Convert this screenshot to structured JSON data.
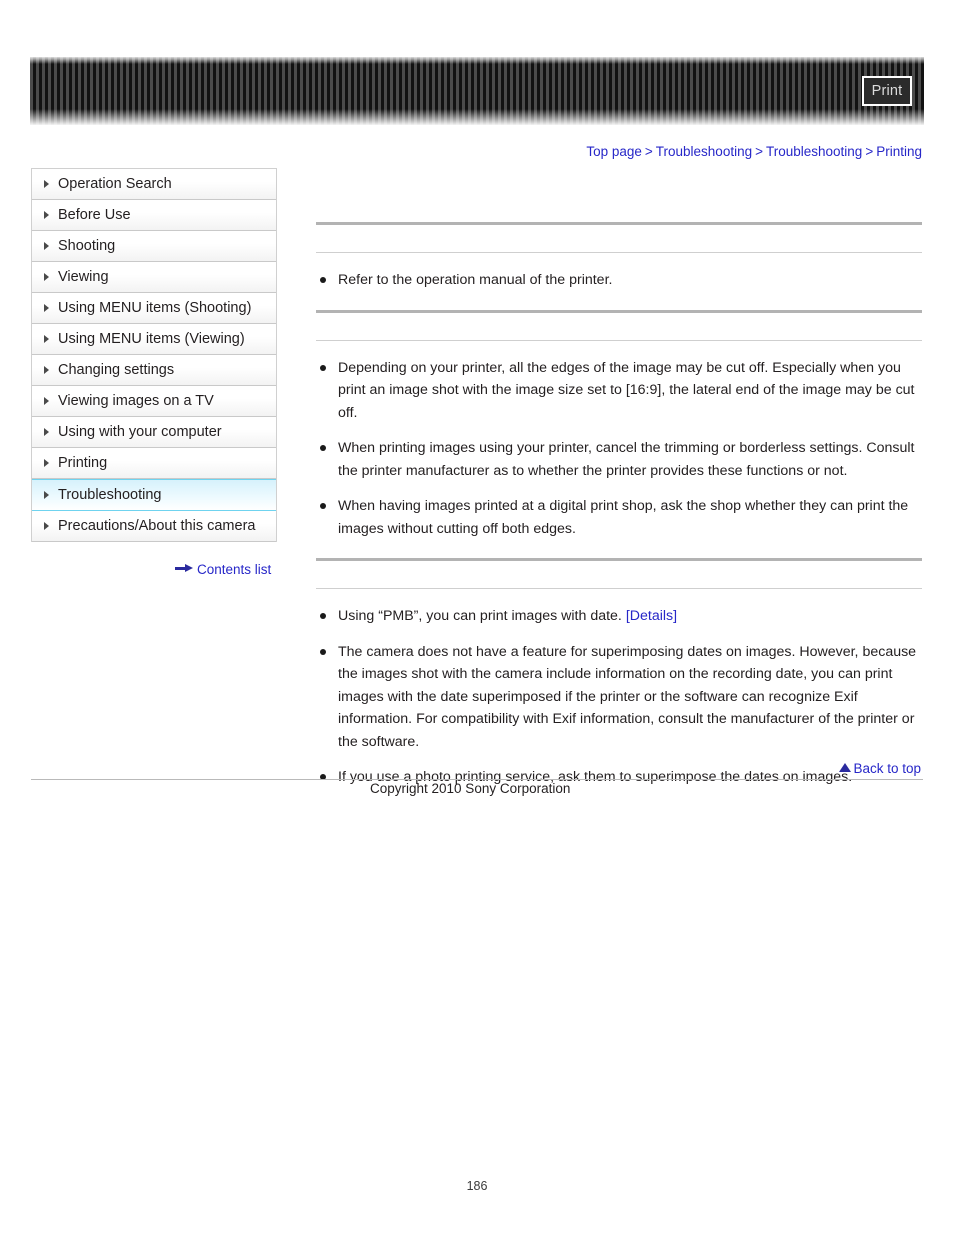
{
  "header": {
    "print_label": "Print"
  },
  "breadcrumb": {
    "items": [
      {
        "label": "Top page"
      },
      {
        "label": "Troubleshooting"
      },
      {
        "label": "Troubleshooting"
      },
      {
        "label": "Printing"
      }
    ],
    "separator": ">"
  },
  "sidebar": {
    "items": [
      {
        "label": "Operation Search",
        "active": false
      },
      {
        "label": "Before Use",
        "active": false
      },
      {
        "label": "Shooting",
        "active": false
      },
      {
        "label": "Viewing",
        "active": false
      },
      {
        "label": "Using MENU items (Shooting)",
        "active": false
      },
      {
        "label": "Using MENU items (Viewing)",
        "active": false
      },
      {
        "label": "Changing settings",
        "active": false
      },
      {
        "label": "Viewing images on a TV",
        "active": false
      },
      {
        "label": "Using with your computer",
        "active": false
      },
      {
        "label": "Printing",
        "active": false
      },
      {
        "label": "Troubleshooting",
        "active": true
      },
      {
        "label": "Precautions/About this camera",
        "active": false
      }
    ],
    "contents_list_label": "Contents list"
  },
  "main": {
    "sections": [
      {
        "title": "",
        "bullets": [
          {
            "text": "Refer to the operation manual of the printer."
          }
        ]
      },
      {
        "title": "",
        "bullets": [
          {
            "text": "Depending on your printer, all the edges of the image may be cut off. Especially when you print an image shot with the image size set to [16:9], the lateral end of the image may be cut off."
          },
          {
            "text": "When printing images using your printer, cancel the trimming or borderless settings. Consult the printer manufacturer as to whether the printer provides these functions or not."
          },
          {
            "text": "When having images printed at a digital print shop, ask the shop whether they can print the images without cutting off both edges."
          }
        ]
      },
      {
        "title": "",
        "bullets": [
          {
            "text": "Using “PMB”, you can print images with date. ",
            "link": "[Details]"
          },
          {
            "text": "The camera does not have a feature for superimposing dates on images. However, because the images shot with the camera include information on the recording date, you can print images with the date superimposed if the printer or the software can recognize Exif information. For compatibility with Exif information, consult the manufacturer of the printer or the software."
          },
          {
            "text": "If you use a photo printing service, ask them to superimpose the dates on images."
          }
        ]
      }
    ]
  },
  "footer": {
    "back_to_top_label": "Back to top",
    "copyright": "Copyright 2010 Sony Corporation",
    "page_number": "186"
  },
  "colors": {
    "link": "#2727c8",
    "active_highlight": "#d6f1fb",
    "active_border": "#6fd3ef",
    "rule_thick": "#b3b3b3",
    "rule_thin": "#cfcfcf"
  }
}
